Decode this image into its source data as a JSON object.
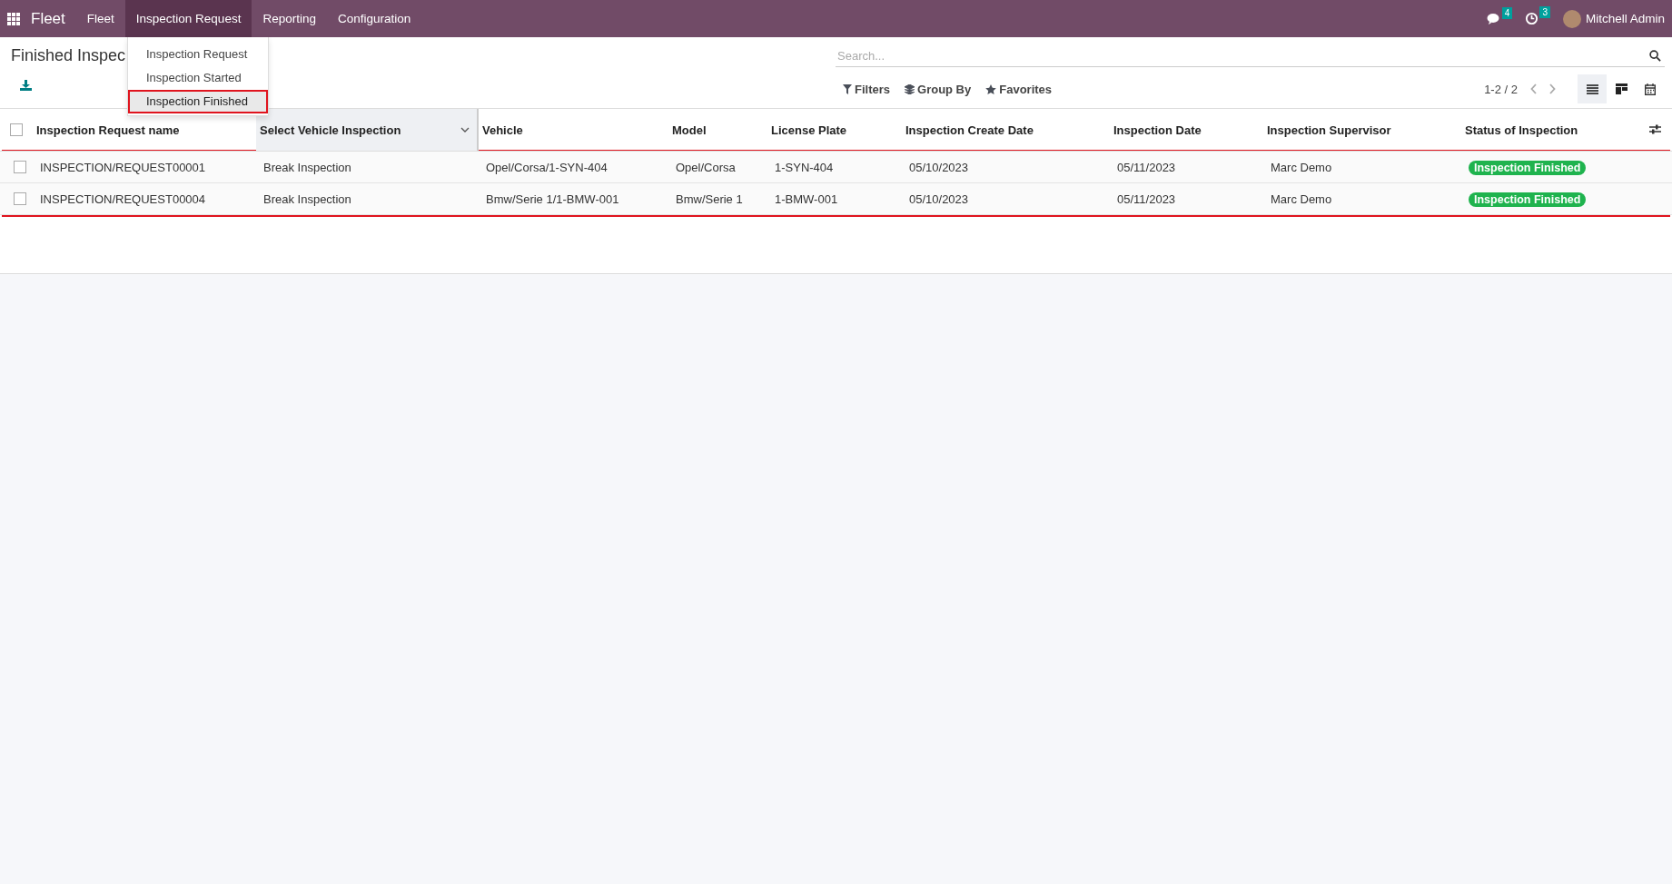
{
  "navbar": {
    "app_name": "Fleet",
    "menus": [
      {
        "label": "Fleet",
        "selected": false
      },
      {
        "label": "Inspection Request",
        "selected": true
      },
      {
        "label": "Reporting",
        "selected": false
      },
      {
        "label": "Configuration",
        "selected": false
      }
    ],
    "messages_count": "4",
    "activities_count": "3",
    "user": "Mitchell Admin"
  },
  "dropdown": {
    "items": [
      {
        "label": "Inspection Request",
        "selected": false
      },
      {
        "label": "Inspection Started",
        "selected": false
      },
      {
        "label": "Inspection Finished",
        "selected": true
      }
    ]
  },
  "control_panel": {
    "title": "Finished Inspec",
    "search": {
      "placeholder": "Search..."
    },
    "filters": "Filters",
    "group_by": "Group By",
    "favorites": "Favorites",
    "pager": "1-2 / 2",
    "views": [
      {
        "kind": "list",
        "selected": true
      },
      {
        "kind": "kanban",
        "selected": false
      },
      {
        "kind": "calendar",
        "selected": false
      }
    ]
  },
  "table": {
    "columns": [
      "Inspection Request name",
      "Select Vehicle Inspection",
      "Vehicle",
      "Model",
      "License Plate",
      "Inspection Create Date",
      "Inspection Date",
      "Inspection Supervisor",
      "Status of Inspection"
    ],
    "rows_highlighted": true,
    "select_all_checked": false,
    "rows": [
      {
        "checked": false,
        "cells": [
          "INSPECTION/REQUEST00001",
          "Break Inspection",
          "Opel/Corsa/1-SYN-404",
          "Opel/Corsa",
          "1-SYN-404",
          "05/10/2023",
          "05/11/2023",
          "Marc Demo"
        ],
        "status": "Inspection Finished"
      },
      {
        "checked": false,
        "cells": [
          "INSPECTION/REQUEST00004",
          "Break Inspection",
          "Bmw/Serie 1/1-BMW-001",
          "Bmw/Serie 1",
          "1-BMW-001",
          "05/10/2023",
          "05/11/2023",
          "Marc Demo"
        ],
        "status": "Inspection Finished"
      }
    ]
  }
}
